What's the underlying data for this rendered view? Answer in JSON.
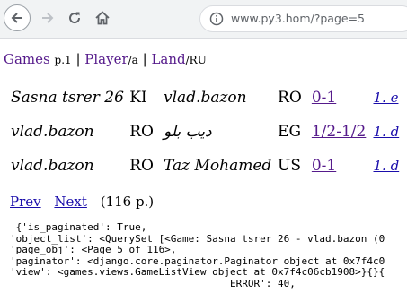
{
  "browser": {
    "url": "www.py3.hom/?page=5"
  },
  "breadcrumb": {
    "games_label": "Games",
    "games_suffix": "p.1",
    "sep1": "|",
    "player_label": "Player",
    "player_suffix": "/a",
    "sep2": "|",
    "land_label": "Land",
    "land_suffix": "/RU"
  },
  "games": [
    {
      "player1": "Sasna tsrer 26",
      "country1": "KI",
      "player2": "vlad.bazon",
      "country2": "RO",
      "result": "0-1",
      "link": "1. e"
    },
    {
      "player1": "vlad.bazon",
      "country1": "RO",
      "player2": "ديب بلو",
      "country2": "EG",
      "result": "1/2-1/2",
      "link": "1. d"
    },
    {
      "player1": "vlad.bazon",
      "country1": "RO",
      "player2": "Taz Mohamed",
      "country2": "US",
      "result": "0-1",
      "link": "1. d"
    }
  ],
  "pager": {
    "prev_label": "Prev",
    "next_label": "Next",
    "count": "(116 p.)"
  },
  "debug_lines": [
    " {'is_paginated': True,",
    "'object_list': <QuerySet [<Game: Sasna tsrer 26 - vlad.bazon (0",
    "'page_obj': <Page 5 of 116>,",
    "'paginator': <django.core.paginator.Paginator object at 0x7f4c0",
    "'view': <games.views.GameListView object at 0x7f4c06cb1908>}{}{",
    "                                     ERROR': 40,"
  ]
}
